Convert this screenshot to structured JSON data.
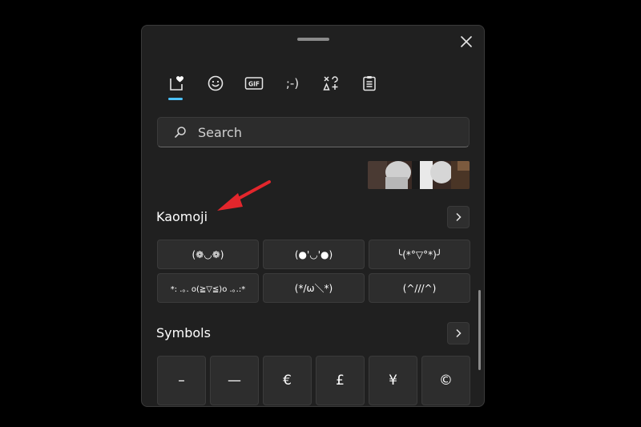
{
  "tabs": [
    {
      "name": "recently-used",
      "icon": "heart-note-icon"
    },
    {
      "name": "emoji",
      "icon": "smiley-icon"
    },
    {
      "name": "gif",
      "icon": "gif-icon",
      "label": "GIF"
    },
    {
      "name": "kaomoji",
      "icon": "kaomoji-icon",
      "label": ";-)"
    },
    {
      "name": "symbols",
      "icon": "symbols-icon"
    },
    {
      "name": "clipboard",
      "icon": "clipboard-icon"
    }
  ],
  "search": {
    "placeholder": "Search"
  },
  "kaomoji": {
    "title": "Kaomoji",
    "items": [
      "(❁◡❁)",
      "(●'◡'●)",
      "╰(*°▽°*)╯",
      "*: .｡. o(≧▽≦)o .｡.:*",
      "(*/ω＼*)",
      "(^///^)"
    ]
  },
  "symbols": {
    "title": "Symbols",
    "items": [
      "–",
      "—",
      "€",
      "£",
      "¥",
      "©"
    ]
  },
  "colors": {
    "accent": "#4cc2ff",
    "arrow": "#e3262c",
    "panel": "#202020"
  }
}
